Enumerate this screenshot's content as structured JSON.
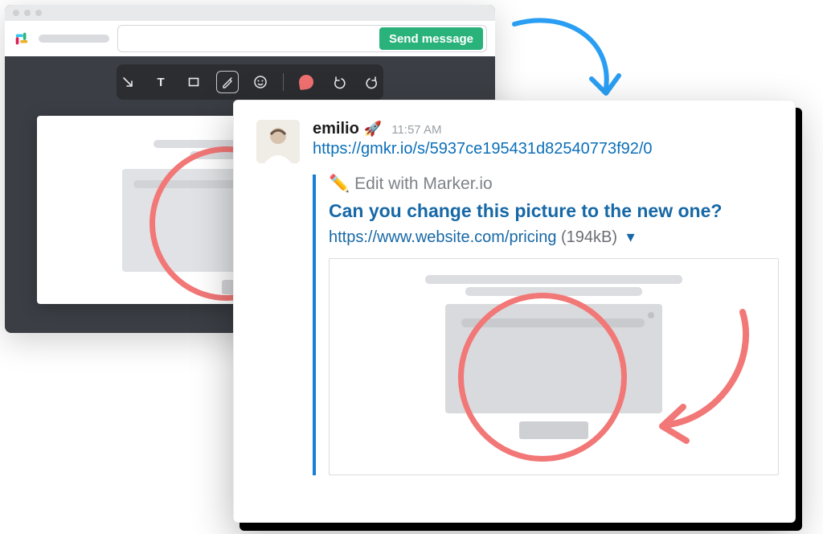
{
  "editor": {
    "send_label": "Send message",
    "toolbar": {
      "tools": [
        "arrow",
        "text",
        "rectangle",
        "pen",
        "emoji",
        "marker",
        "undo",
        "redo"
      ],
      "active": "pen"
    }
  },
  "message": {
    "username": "emilio",
    "emoji": "🚀",
    "timestamp": "11:57 AM",
    "url": "https://gmkr.io/s/5937ce195431d82540773f92/0",
    "attachment": {
      "edit_icon": "✏️",
      "edit_label": "Edit with Marker.io",
      "title": "Can you change this picture to the new one?",
      "link": "https://www.website.com/pricing",
      "size": "(194kB)"
    }
  },
  "colors": {
    "accent_green": "#2ab27b",
    "link_blue": "#1768a6",
    "annotation_red": "#f27777",
    "flow_arrow": "#2a9ef2"
  }
}
